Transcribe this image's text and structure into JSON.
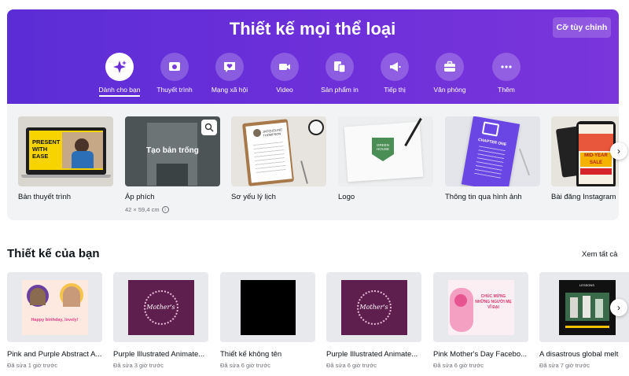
{
  "hero": {
    "title": "Thiết kế mọi thể loại",
    "custom_size_label": "Cỡ tùy chỉnh",
    "categories": [
      {
        "label": "Dành cho bạn",
        "icon": "sparkle-icon"
      },
      {
        "label": "Thuyết trình",
        "icon": "presentation-icon"
      },
      {
        "label": "Mạng xã hội",
        "icon": "heart-chat-icon"
      },
      {
        "label": "Video",
        "icon": "video-camera-icon"
      },
      {
        "label": "Sản phẩm in",
        "icon": "print-products-icon"
      },
      {
        "label": "Tiếp thị",
        "icon": "megaphone-icon"
      },
      {
        "label": "Văn phòng",
        "icon": "briefcase-icon"
      },
      {
        "label": "Thêm",
        "icon": "more-dots-icon"
      }
    ],
    "active_category": "Dành cho bạn",
    "accent": "#6b2fd9"
  },
  "templates": {
    "items": [
      {
        "label": "Bản thuyết trình",
        "thumb_text": "PRESENT WITH EASE"
      },
      {
        "label": "Áp phích",
        "sub": "42 × 59,4 cm",
        "hover_text": "Tạo bản trống"
      },
      {
        "label": "Sơ yếu lý lịch",
        "thumb_text": "JACQUELINE THOMPSON"
      },
      {
        "label": "Logo",
        "thumb_text": "GREEN HOUSE"
      },
      {
        "label": "Thông tin qua hình ảnh",
        "thumb_text": "CHAPTER ONE"
      },
      {
        "label": "Bài đăng Instagram",
        "thumb_text": "MID-YEAR SALE"
      }
    ]
  },
  "designs": {
    "section_title": "Thiết kế của bạn",
    "see_all": "Xem tất cả",
    "items": [
      {
        "title": "Pink and Purple Abstract A...",
        "edited": "Đã sửa 1 giờ trước",
        "thumb_text": "Happy birthday, lovely!"
      },
      {
        "title": "Purple Illustrated Animate...",
        "edited": "Đã sửa 3 giờ trước",
        "thumb_text": "Mother's"
      },
      {
        "title": "Thiết kế không tên",
        "edited": "Đã sửa 6 giờ trước"
      },
      {
        "title": "Purple Illustrated Animate...",
        "edited": "Đã sửa 6 giờ trước",
        "thumb_text": "Mother's"
      },
      {
        "title": "Pink Mother's Day Facebo...",
        "edited": "Đã sửa 6 giờ trước",
        "thumb_text": "CHÚC MỪNG NHỮNG NGƯỜI MẸ VĨ ĐẠI"
      },
      {
        "title": "A disastrous global melt",
        "edited": "Đã sửa 7 giờ trước",
        "thumb_text": "LESSONS"
      }
    ]
  }
}
